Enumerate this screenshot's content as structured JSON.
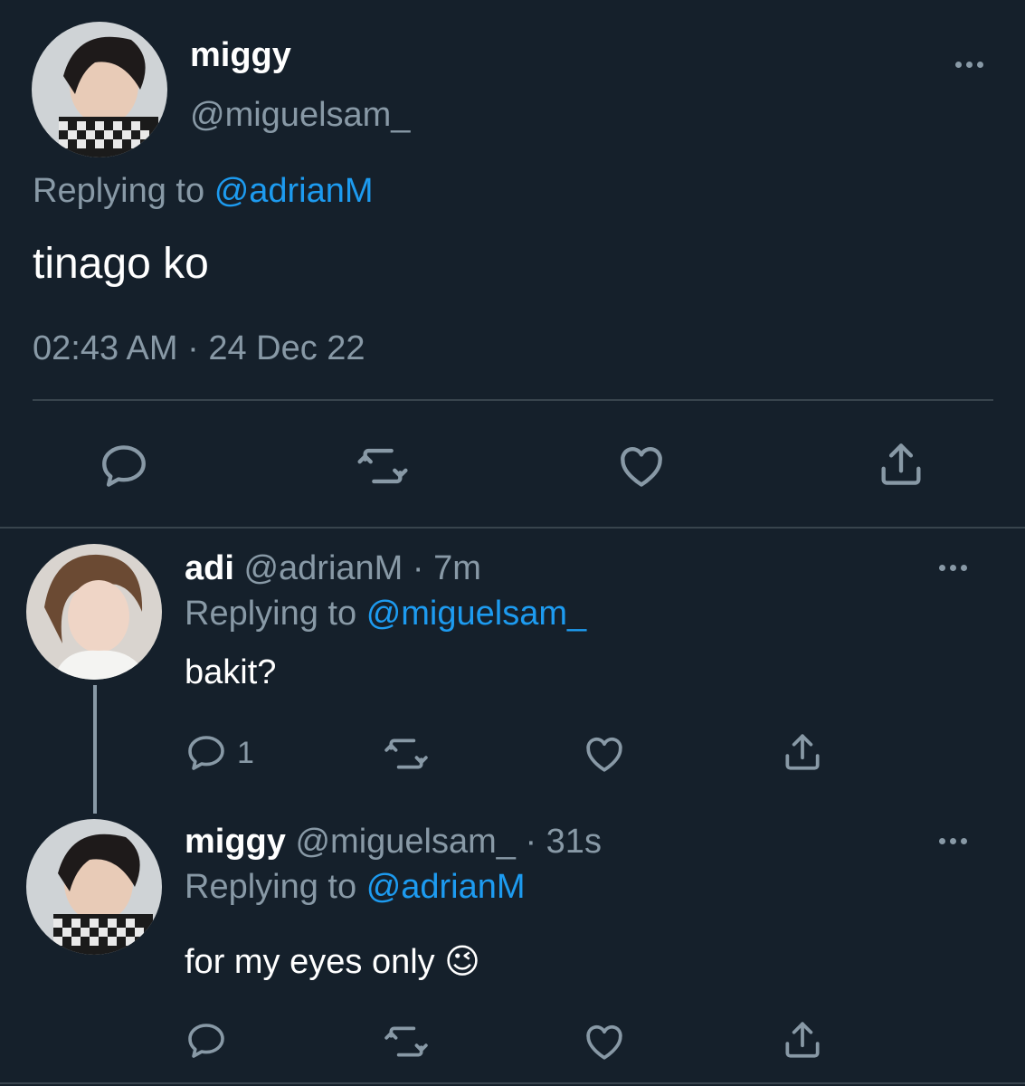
{
  "main_tweet": {
    "display_name": "miggy",
    "handle": "@miguelsam_",
    "replying_prefix": "Replying to",
    "replying_to": "@adrianM",
    "text": "tinago ko",
    "timestamp": "02:43 AM · 24 Dec 22"
  },
  "reply1": {
    "display_name": "adi",
    "handle_time": "@adrianM · 7m",
    "replying_prefix": "Replying to",
    "replying_to": "@miguelsam_",
    "text": "bakit?",
    "reply_count": "1"
  },
  "reply2": {
    "display_name": "miggy",
    "handle_time": "@miguelsam_ · 31s",
    "replying_prefix": "Replying to",
    "replying_to": "@adrianM",
    "text": "for my eyes only",
    "emoji": "😉"
  },
  "icons": [
    "reply-icon",
    "retweet-icon",
    "like-icon",
    "share-icon",
    "more-icon"
  ],
  "colors": {
    "background": "#15202b",
    "accent": "#1d9bf0",
    "muted": "#8899a6",
    "divider": "#38444d"
  }
}
